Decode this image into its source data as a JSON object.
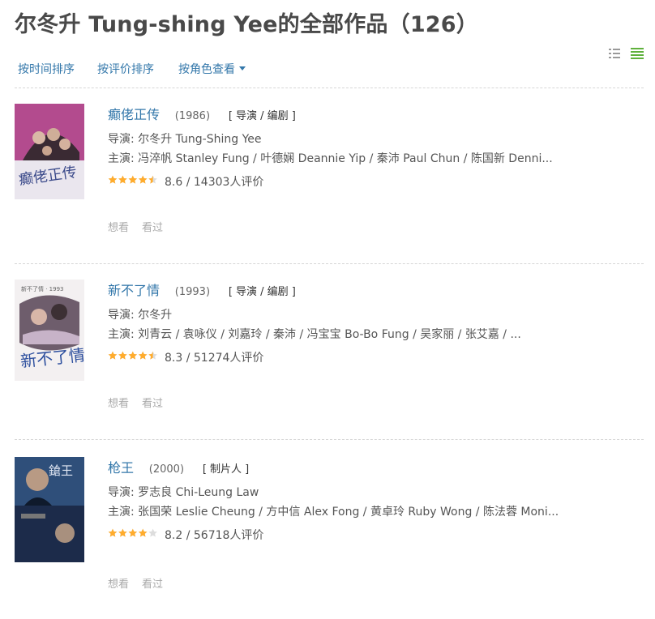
{
  "page": {
    "title": "尔冬升 Tung-shing Yee的全部作品（126）"
  },
  "sort": {
    "by_time": "按时间排序",
    "by_rating": "按评价排序",
    "by_role": "按角色查看"
  },
  "view_icons": [
    "list-view-icon",
    "grid-view-icon"
  ],
  "colors": {
    "link": "#3377aa",
    "star": "#ffac2d",
    "star_empty": "#dddddd",
    "grid_icon": "#5fb13c"
  },
  "labels": {
    "director": "导演:",
    "cast": "主演:",
    "want": "想看",
    "seen": "看过"
  },
  "films": [
    {
      "title": "癫佬正传",
      "year": "(1986)",
      "roles": "[ 导演 / 编剧 ]",
      "director": "尔冬升 Tung-Shing Yee",
      "cast": "冯淬帆 Stanley Fung / 叶德娴 Deannie Yip / 秦沛 Paul Chun / 陈国新 Denni...",
      "rating_value": 8.6,
      "rating_text": "8.6 / 14303人评价",
      "stars": 4.5
    },
    {
      "title": "新不了情",
      "year": "(1993)",
      "roles": "[ 导演 / 编剧 ]",
      "director": "尔冬升",
      "cast": "刘青云 / 袁咏仪 / 刘嘉玲 / 秦沛 / 冯宝宝 Bo-Bo Fung / 吴家丽 / 张艾嘉 / ...",
      "rating_value": 8.3,
      "rating_text": "8.3 / 51274人评价",
      "stars": 4.5
    },
    {
      "title": "枪王",
      "year": "(2000)",
      "roles": "[ 制片人 ]",
      "director": "罗志良 Chi-Leung Law",
      "cast": "张国荣 Leslie Cheung / 方中信 Alex Fong / 黄卓玲 Ruby Wong / 陈法蓉 Moni...",
      "rating_value": 8.2,
      "rating_text": "8.2 / 56718人评价",
      "stars": 4
    }
  ]
}
